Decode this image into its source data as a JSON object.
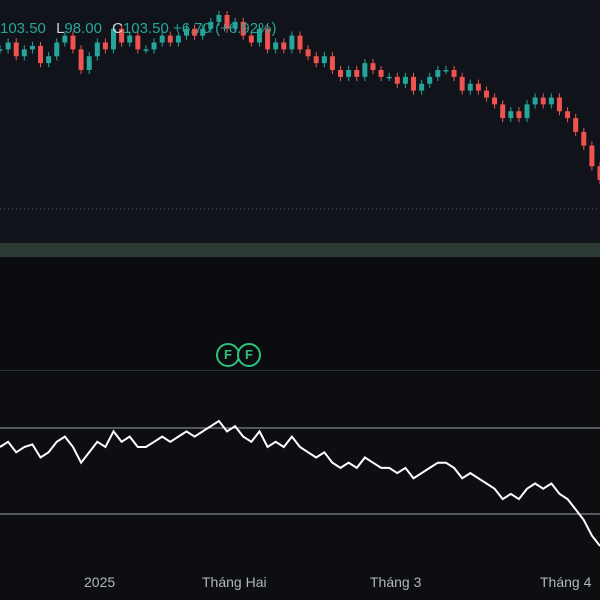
{
  "header": {
    "close_prefix": "103.50",
    "low_key": "L",
    "low_value": "98.00",
    "close_key": "C",
    "close_value": "103.50",
    "change_value": "+6.70 (+6.92%)"
  },
  "markers": [
    "F",
    "F"
  ],
  "time_axis": [
    "2025",
    "Tháng Hai",
    "Tháng 3",
    "Tháng 4"
  ],
  "colors": {
    "up": "#26a69a",
    "down": "#ef5350",
    "marker": "#2ec27e",
    "line": "#ffffff",
    "band": "#9aa0aa"
  },
  "chart_data": [
    {
      "type": "line",
      "series": [
        {
          "values": [
            100,
            101,
            99,
            100,
            100.5,
            98,
            99,
            101,
            102,
            100,
            97,
            99,
            101,
            100,
            103,
            101,
            102,
            100,
            100,
            101,
            102,
            101,
            102,
            103,
            102,
            103,
            104,
            105,
            103,
            104,
            102,
            101,
            103,
            100,
            101,
            100,
            102,
            100,
            99,
            98,
            99,
            97,
            96,
            97,
            96,
            98,
            97,
            96,
            96,
            95,
            96,
            94,
            95,
            96,
            97,
            97,
            96,
            94,
            95,
            94,
            93,
            92,
            90,
            91,
            90,
            92,
            93,
            92,
            93,
            91,
            90,
            88,
            86,
            83,
            81
          ]
        }
      ]
    }
  ]
}
